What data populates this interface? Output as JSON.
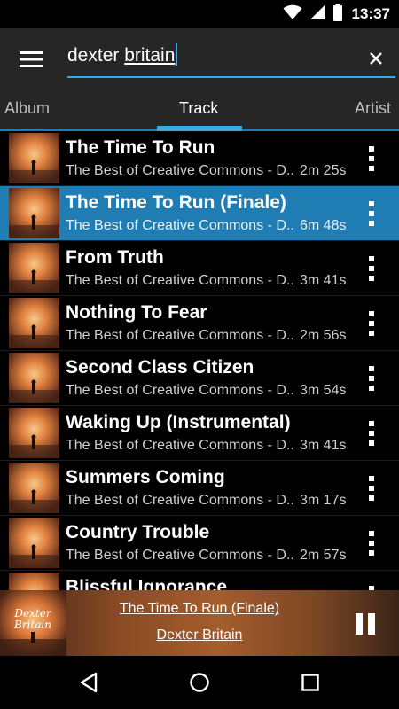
{
  "status_bar": {
    "time": "13:37",
    "icons": [
      "wifi-icon",
      "signal-icon",
      "battery-icon"
    ]
  },
  "toolbar": {
    "menu_icon": "hamburger-menu-icon",
    "search_value_part1": "dexter ",
    "search_value_part2": "britain",
    "clear_icon": "close-icon"
  },
  "tabs": [
    {
      "label": "Album",
      "active": false
    },
    {
      "label": "Track",
      "active": true
    },
    {
      "label": "Artist",
      "active": false
    }
  ],
  "tracks": [
    {
      "title": "The Time To Run",
      "subtitle": "The Best of Creative Commons - D..",
      "duration": "2m 25s",
      "selected": false
    },
    {
      "title": "The Time To Run (Finale)",
      "subtitle": "The Best of Creative Commons - D..",
      "duration": "6m 48s",
      "selected": true
    },
    {
      "title": "From Truth",
      "subtitle": "The Best of Creative Commons - D..",
      "duration": "3m 41s",
      "selected": false
    },
    {
      "title": "Nothing To Fear",
      "subtitle": "The Best of Creative Commons - D..",
      "duration": "2m 56s",
      "selected": false
    },
    {
      "title": "Second Class Citizen",
      "subtitle": "The Best of Creative Commons - D..",
      "duration": "3m 54s",
      "selected": false
    },
    {
      "title": "Waking Up (Instrumental)",
      "subtitle": "The Best of Creative Commons - D..",
      "duration": "3m 41s",
      "selected": false
    },
    {
      "title": "Summers Coming",
      "subtitle": "The Best of Creative Commons - D..",
      "duration": "3m 17s",
      "selected": false
    },
    {
      "title": "Country Trouble",
      "subtitle": "The Best of Creative Commons - D..",
      "duration": "2m 57s",
      "selected": false
    },
    {
      "title": "Blissful Ignorance",
      "subtitle": "",
      "duration": "",
      "selected": false
    }
  ],
  "now_playing": {
    "title": "The Time To Run (Finale)",
    "artist": "Dexter Britain",
    "cover_text_line1": "Dexter",
    "cover_text_line2": "Britain",
    "pause_icon": "pause-icon"
  },
  "nav_bar": {
    "icons": [
      "back-icon",
      "home-icon",
      "recents-icon"
    ]
  },
  "colors": {
    "accent": "#3aa9e0",
    "selected_row": "#1f7db4",
    "toolbar": "#262626"
  }
}
